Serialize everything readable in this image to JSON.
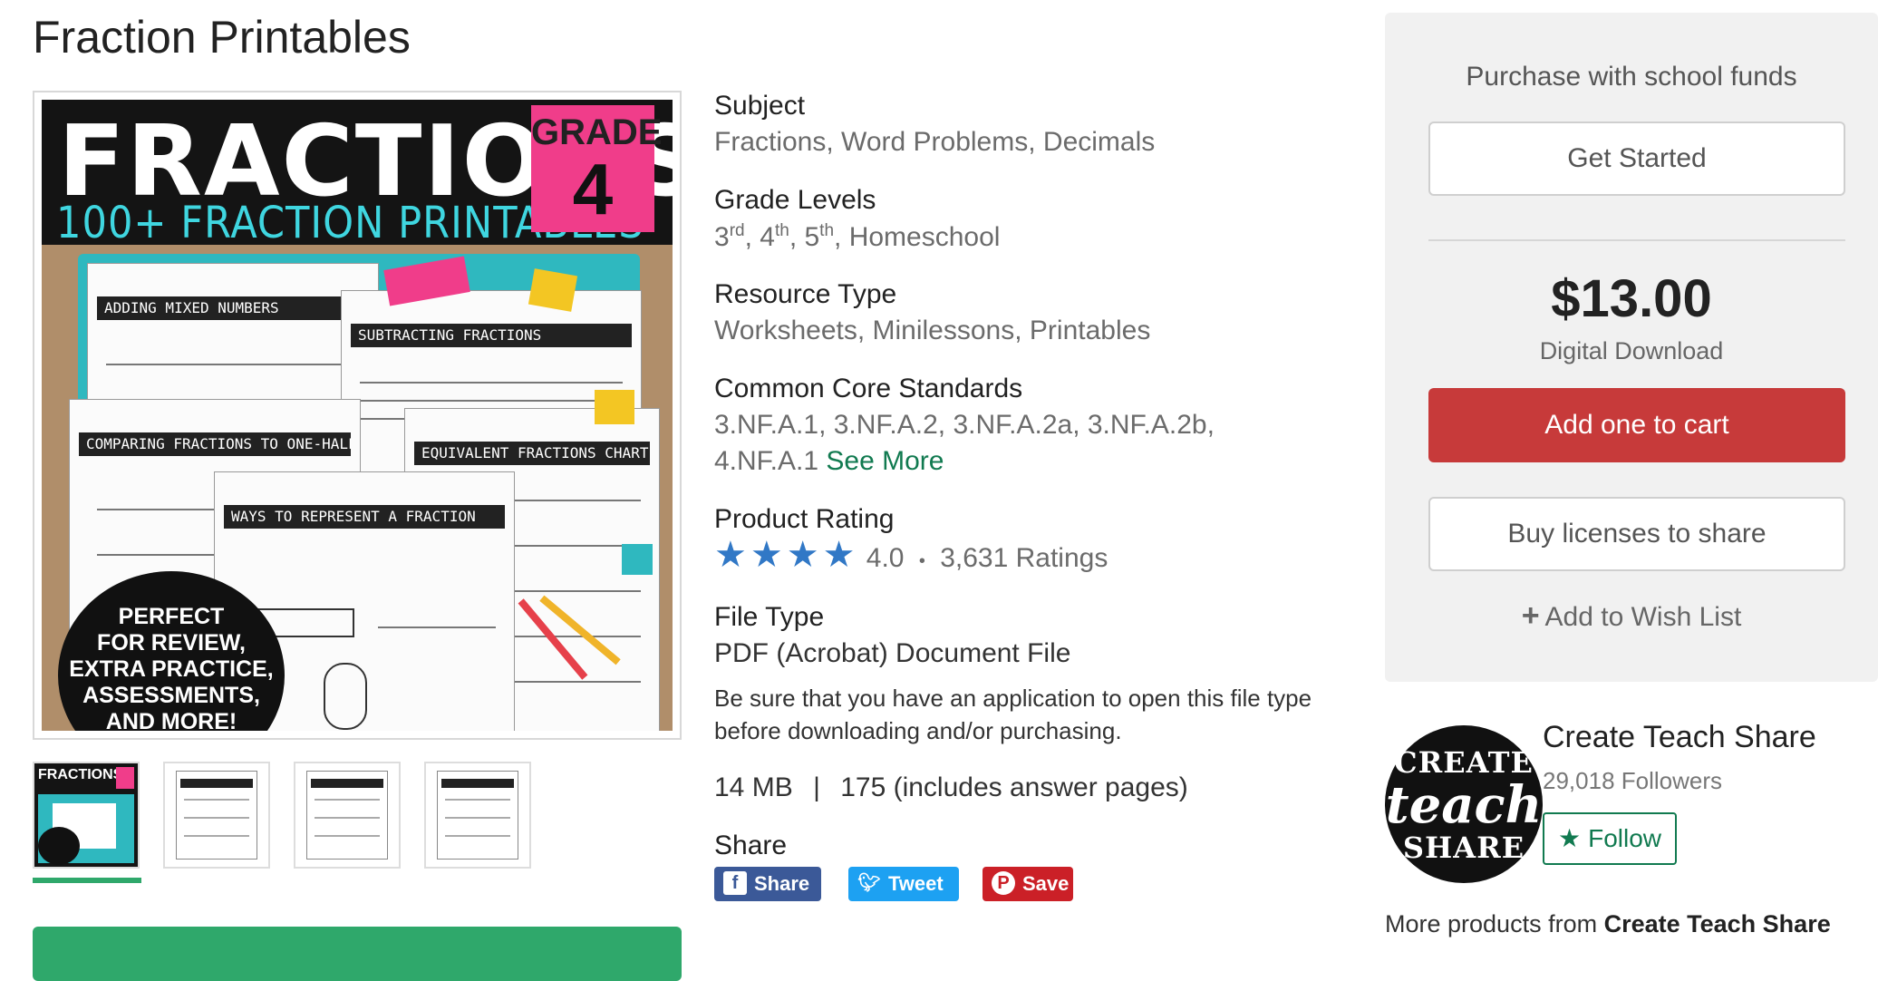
{
  "page": {
    "title": "Fraction Printables"
  },
  "cover": {
    "title": "FRACTIONS",
    "subtitle": "100+ FRACTION PRINTABLES",
    "grade_word": "GRADE",
    "grade_num": "4",
    "sheet1": "ADDING MIXED NUMBERS",
    "sheet2": "SUBTRACTING FRACTIONS",
    "sheet3": "COMPARING FRACTIONS TO ONE-HALF",
    "sheet4": "EQUIVALENT FRACTIONS CHART",
    "sheet5": "WAYS TO REPRESENT A FRACTION",
    "badge_lines": [
      "PERFECT",
      "FOR REVIEW,",
      "EXTRA PRACTICE,",
      "ASSESSMENTS,",
      "AND MORE!"
    ]
  },
  "details": {
    "subject": {
      "label": "Subject",
      "values": [
        "Fractions",
        "Word Problems",
        "Decimals"
      ]
    },
    "grade_levels": {
      "label": "Grade Levels",
      "g3": "3",
      "g3_sup": "rd",
      "g4": "4",
      "g4_sup": "th",
      "g5": "5",
      "g5_sup": "th",
      "extra": "Homeschool"
    },
    "resource_type": {
      "label": "Resource Type",
      "values": [
        "Worksheets",
        "Minilessons",
        "Printables"
      ]
    },
    "common_core": {
      "label": "Common Core Standards",
      "values": [
        "3.NF.A.1",
        "3.NF.A.2",
        "3.NF.A.2a",
        "3.NF.A.2b",
        "4.NF.A.1"
      ],
      "see_more": "See More"
    },
    "rating": {
      "label": "Product Rating",
      "value": "4.0",
      "stars": 4,
      "count": "3,631 Ratings",
      "separator": "•"
    },
    "file_type": {
      "label": "File Type",
      "value": "PDF (Acrobat) Document File",
      "note": "Be sure that you have an application to open this file type before downloading and/or purchasing."
    },
    "size": "14 MB",
    "size_sep": "|",
    "pages": "175 (includes answer pages)",
    "share": {
      "label": "Share",
      "facebook": "Share",
      "twitter": "Tweet",
      "pinterest": "Save"
    }
  },
  "purchase": {
    "school_funds": "Purchase with school funds",
    "get_started": "Get Started",
    "price": "$13.00",
    "download_type": "Digital Download",
    "add_to_cart": "Add one to cart",
    "buy_licenses": "Buy licenses to share",
    "wish_list": "Add to Wish List"
  },
  "seller": {
    "name": "Create Teach Share",
    "followers": "29,018 Followers",
    "follow": "Follow",
    "logo_lines": [
      "CREATE",
      "teach",
      "SHARE"
    ],
    "more_prefix": "More products from",
    "more_name": "Create Teach Share"
  },
  "colors": {
    "accent_green": "#117a50",
    "cart_red": "#c73a3a",
    "star_blue": "#3178c6",
    "panel_bg": "#f1f1f1"
  }
}
